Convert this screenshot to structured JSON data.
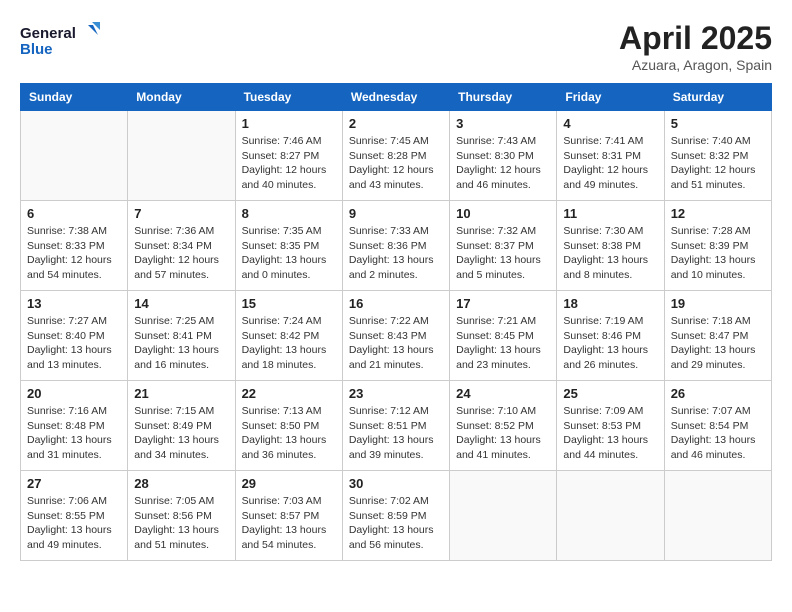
{
  "header": {
    "logo_line1": "General",
    "logo_line2": "Blue",
    "month": "April 2025",
    "location": "Azuara, Aragon, Spain"
  },
  "days_of_week": [
    "Sunday",
    "Monday",
    "Tuesday",
    "Wednesday",
    "Thursday",
    "Friday",
    "Saturday"
  ],
  "weeks": [
    [
      {
        "day": "",
        "sunrise": "",
        "sunset": "",
        "daylight": ""
      },
      {
        "day": "",
        "sunrise": "",
        "sunset": "",
        "daylight": ""
      },
      {
        "day": "1",
        "sunrise": "Sunrise: 7:46 AM",
        "sunset": "Sunset: 8:27 PM",
        "daylight": "Daylight: 12 hours and 40 minutes."
      },
      {
        "day": "2",
        "sunrise": "Sunrise: 7:45 AM",
        "sunset": "Sunset: 8:28 PM",
        "daylight": "Daylight: 12 hours and 43 minutes."
      },
      {
        "day": "3",
        "sunrise": "Sunrise: 7:43 AM",
        "sunset": "Sunset: 8:30 PM",
        "daylight": "Daylight: 12 hours and 46 minutes."
      },
      {
        "day": "4",
        "sunrise": "Sunrise: 7:41 AM",
        "sunset": "Sunset: 8:31 PM",
        "daylight": "Daylight: 12 hours and 49 minutes."
      },
      {
        "day": "5",
        "sunrise": "Sunrise: 7:40 AM",
        "sunset": "Sunset: 8:32 PM",
        "daylight": "Daylight: 12 hours and 51 minutes."
      }
    ],
    [
      {
        "day": "6",
        "sunrise": "Sunrise: 7:38 AM",
        "sunset": "Sunset: 8:33 PM",
        "daylight": "Daylight: 12 hours and 54 minutes."
      },
      {
        "day": "7",
        "sunrise": "Sunrise: 7:36 AM",
        "sunset": "Sunset: 8:34 PM",
        "daylight": "Daylight: 12 hours and 57 minutes."
      },
      {
        "day": "8",
        "sunrise": "Sunrise: 7:35 AM",
        "sunset": "Sunset: 8:35 PM",
        "daylight": "Daylight: 13 hours and 0 minutes."
      },
      {
        "day": "9",
        "sunrise": "Sunrise: 7:33 AM",
        "sunset": "Sunset: 8:36 PM",
        "daylight": "Daylight: 13 hours and 2 minutes."
      },
      {
        "day": "10",
        "sunrise": "Sunrise: 7:32 AM",
        "sunset": "Sunset: 8:37 PM",
        "daylight": "Daylight: 13 hours and 5 minutes."
      },
      {
        "day": "11",
        "sunrise": "Sunrise: 7:30 AM",
        "sunset": "Sunset: 8:38 PM",
        "daylight": "Daylight: 13 hours and 8 minutes."
      },
      {
        "day": "12",
        "sunrise": "Sunrise: 7:28 AM",
        "sunset": "Sunset: 8:39 PM",
        "daylight": "Daylight: 13 hours and 10 minutes."
      }
    ],
    [
      {
        "day": "13",
        "sunrise": "Sunrise: 7:27 AM",
        "sunset": "Sunset: 8:40 PM",
        "daylight": "Daylight: 13 hours and 13 minutes."
      },
      {
        "day": "14",
        "sunrise": "Sunrise: 7:25 AM",
        "sunset": "Sunset: 8:41 PM",
        "daylight": "Daylight: 13 hours and 16 minutes."
      },
      {
        "day": "15",
        "sunrise": "Sunrise: 7:24 AM",
        "sunset": "Sunset: 8:42 PM",
        "daylight": "Daylight: 13 hours and 18 minutes."
      },
      {
        "day": "16",
        "sunrise": "Sunrise: 7:22 AM",
        "sunset": "Sunset: 8:43 PM",
        "daylight": "Daylight: 13 hours and 21 minutes."
      },
      {
        "day": "17",
        "sunrise": "Sunrise: 7:21 AM",
        "sunset": "Sunset: 8:45 PM",
        "daylight": "Daylight: 13 hours and 23 minutes."
      },
      {
        "day": "18",
        "sunrise": "Sunrise: 7:19 AM",
        "sunset": "Sunset: 8:46 PM",
        "daylight": "Daylight: 13 hours and 26 minutes."
      },
      {
        "day": "19",
        "sunrise": "Sunrise: 7:18 AM",
        "sunset": "Sunset: 8:47 PM",
        "daylight": "Daylight: 13 hours and 29 minutes."
      }
    ],
    [
      {
        "day": "20",
        "sunrise": "Sunrise: 7:16 AM",
        "sunset": "Sunset: 8:48 PM",
        "daylight": "Daylight: 13 hours and 31 minutes."
      },
      {
        "day": "21",
        "sunrise": "Sunrise: 7:15 AM",
        "sunset": "Sunset: 8:49 PM",
        "daylight": "Daylight: 13 hours and 34 minutes."
      },
      {
        "day": "22",
        "sunrise": "Sunrise: 7:13 AM",
        "sunset": "Sunset: 8:50 PM",
        "daylight": "Daylight: 13 hours and 36 minutes."
      },
      {
        "day": "23",
        "sunrise": "Sunrise: 7:12 AM",
        "sunset": "Sunset: 8:51 PM",
        "daylight": "Daylight: 13 hours and 39 minutes."
      },
      {
        "day": "24",
        "sunrise": "Sunrise: 7:10 AM",
        "sunset": "Sunset: 8:52 PM",
        "daylight": "Daylight: 13 hours and 41 minutes."
      },
      {
        "day": "25",
        "sunrise": "Sunrise: 7:09 AM",
        "sunset": "Sunset: 8:53 PM",
        "daylight": "Daylight: 13 hours and 44 minutes."
      },
      {
        "day": "26",
        "sunrise": "Sunrise: 7:07 AM",
        "sunset": "Sunset: 8:54 PM",
        "daylight": "Daylight: 13 hours and 46 minutes."
      }
    ],
    [
      {
        "day": "27",
        "sunrise": "Sunrise: 7:06 AM",
        "sunset": "Sunset: 8:55 PM",
        "daylight": "Daylight: 13 hours and 49 minutes."
      },
      {
        "day": "28",
        "sunrise": "Sunrise: 7:05 AM",
        "sunset": "Sunset: 8:56 PM",
        "daylight": "Daylight: 13 hours and 51 minutes."
      },
      {
        "day": "29",
        "sunrise": "Sunrise: 7:03 AM",
        "sunset": "Sunset: 8:57 PM",
        "daylight": "Daylight: 13 hours and 54 minutes."
      },
      {
        "day": "30",
        "sunrise": "Sunrise: 7:02 AM",
        "sunset": "Sunset: 8:59 PM",
        "daylight": "Daylight: 13 hours and 56 minutes."
      },
      {
        "day": "",
        "sunrise": "",
        "sunset": "",
        "daylight": ""
      },
      {
        "day": "",
        "sunrise": "",
        "sunset": "",
        "daylight": ""
      },
      {
        "day": "",
        "sunrise": "",
        "sunset": "",
        "daylight": ""
      }
    ]
  ]
}
